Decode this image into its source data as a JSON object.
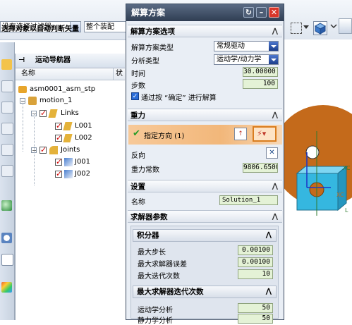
{
  "toolbar": {
    "filter_combo": "没有选择过滤器",
    "assembly_combo": "整个装配",
    "hint": "选择对象以自动判断矢量"
  },
  "navigator": {
    "title": "运动导航器",
    "col_name": "名称",
    "col_state": "状",
    "tree": {
      "root": "asm0001_asm_stp",
      "motion": "motion_1",
      "links": "Links",
      "link1": "L001",
      "link2": "L002",
      "joints": "Joints",
      "joint1": "J001",
      "joint2": "J002"
    }
  },
  "dialog": {
    "title": "解算方案",
    "sec_options": "解算方案选项",
    "solution_type_label": "解算方案类型",
    "solution_type_value": "常规驱动",
    "analysis_type_label": "分析类型",
    "analysis_type_value": "运动学/动力学",
    "time_label": "时间",
    "time_value": "30.00000",
    "steps_label": "步数",
    "steps_value": "100",
    "solve_on_ok_label": "通过按 “确定” 进行解算",
    "sec_gravity": "重力",
    "specify_direction": "指定方向 (1)",
    "reverse_label": "反向",
    "gravity_const_label": "重力常数",
    "gravity_const_value": "9806.6500",
    "sec_settings": "设置",
    "name_label": "名称",
    "name_value": "Solution_1",
    "sec_solver": "求解器参数",
    "sub_integrator": "积分器",
    "max_step_label": "最大步长",
    "max_step_value": "0.00100",
    "max_error_label": "最大求解器误差",
    "max_error_value": "0.00100",
    "max_iter_label": "最大迭代次数",
    "max_iter_value": "10",
    "sub_max_iter": "最大求解器迭代次数",
    "kinematic_label": "运动学分析",
    "kinematic_value": "50",
    "static_label": "静力学分析",
    "static_value": "50"
  },
  "view": {
    "axis_x": "XC",
    "axis_x2": "XC",
    "axis_l": "L"
  },
  "colors": {
    "dialog_title_bg": "#3b4a60",
    "wheel": "#c46a1b",
    "block": "#35b7e0",
    "direction_highlight": "#f2b77a",
    "checkbox_check": "#d00000",
    "close_button": "#d8362a"
  }
}
